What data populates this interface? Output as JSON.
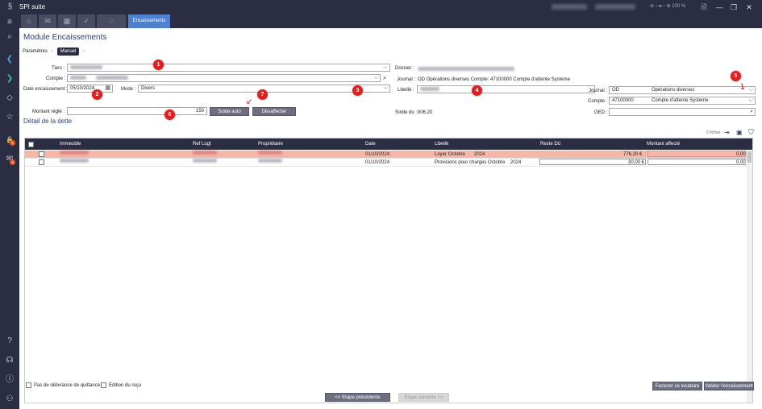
{
  "titlebar": {
    "app_title": "SPI suite",
    "zoom_label": "100 %",
    "minimize": "—",
    "maximize": "❐",
    "close": "✕"
  },
  "tabs": [
    {
      "icon": "home-icon",
      "glyph": "⌂"
    },
    {
      "icon": "mail-icon",
      "glyph": "✉"
    },
    {
      "icon": "calendar-icon",
      "glyph": "▦"
    },
    {
      "icon": "check-icon",
      "glyph": "✓"
    },
    {
      "icon": "bell-icon",
      "glyph": "♢"
    },
    {
      "label": "Encaissements",
      "active": true
    }
  ],
  "leftnav": {
    "items": [
      {
        "icon": "menu-icon",
        "glyph": "≡"
      },
      {
        "icon": "search-icon",
        "glyph": "⌕"
      },
      {
        "icon": "back-arrow-icon",
        "glyph": "❮"
      },
      {
        "icon": "forward-arrow-icon",
        "glyph": "❯"
      },
      {
        "icon": "diamond-icon",
        "glyph": "◇"
      },
      {
        "icon": "star-icon",
        "glyph": "☆"
      },
      {
        "icon": "lock-icon",
        "glyph": "🔒"
      },
      {
        "icon": "envelope-icon",
        "glyph": "✉"
      },
      {
        "icon": "help-icon",
        "glyph": "?"
      },
      {
        "icon": "headset-icon",
        "glyph": "☊"
      },
      {
        "icon": "info-icon",
        "glyph": "ⓘ"
      },
      {
        "icon": "user-icon",
        "glyph": "⚇"
      }
    ],
    "badges": [
      "1",
      "4"
    ]
  },
  "page": {
    "title": "Module Encaissements",
    "breadcrumb": {
      "parametres": "Paramètres",
      "manuel": "Manuel"
    }
  },
  "form": {
    "tiers_label": "Tiers :",
    "compte_label": "Compte :",
    "date_label": "Date encaissement :",
    "date_value": "05/10/2024",
    "mode_label": "Mode :",
    "mode_value": "Divers",
    "libelle_label": "Libellé :",
    "montant_label": "Montant réglé :",
    "montant_value": "150",
    "solde_auto": "Solde auto",
    "desaffecter": "Désaffecter",
    "dossier_label": "Dossier :",
    "journal_label": "Journal :",
    "journal_info": "OD Opérations diverses Compte: 47100000 Compte d'attente Systeme",
    "solde_du_label": "Solde du :",
    "solde_du_value": "806,20",
    "journal2_label": "Journal :",
    "journal2_code": "OD",
    "journal2_name": "Opérations diverses",
    "compte2_label": "Compte :",
    "compte2_code": "47100000",
    "compte2_name": "Compte d'attente Systeme",
    "ged_label": "GED :"
  },
  "markers": [
    "1",
    "2",
    "3",
    "4",
    "5",
    "6",
    "7"
  ],
  "section": {
    "title": "Détail de la dette",
    "count": "2 fiches"
  },
  "table": {
    "columns": [
      "Immeuble",
      "Ref Logt",
      "Propriétaire",
      "Date",
      "Libellé",
      "Reste Dû",
      "Montant affecté"
    ],
    "rows": [
      {
        "date": "01/10/2024",
        "libelle": "Loyer Octobre",
        "annee": "2024",
        "reste": "776,20 €",
        "montant": "0,00 €"
      },
      {
        "date": "01/10/2024",
        "libelle": "Provisions pour charges Octobre",
        "annee": "2024",
        "reste": "30,00 €",
        "montant": "0,00 €"
      }
    ]
  },
  "footer": {
    "pas_delivrance": "Pas de délivrance de quittance",
    "edition_recu": "Edition du reçu",
    "facturer": "Facturer ce locataire",
    "valider": "Valider l'encaissement",
    "precedente": "<< Etape précédente",
    "suivante": "Etape suivante >>"
  },
  "colors": {
    "navy": "#2b2d42",
    "accent": "#4f7fcf",
    "marker": "#e02020",
    "highlight_row": "#f4b7a8"
  }
}
